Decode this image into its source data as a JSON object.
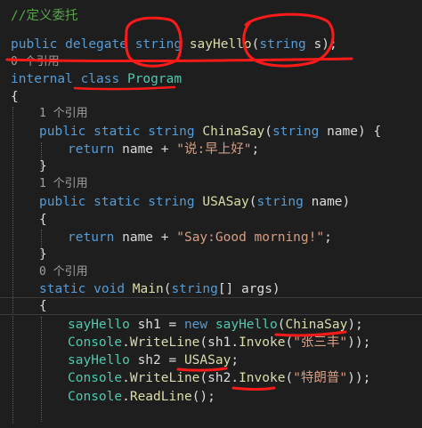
{
  "code": {
    "comment": "//定义委托",
    "l1": {
      "kw1": "public",
      "kw2": "delegate",
      "kw3": "string",
      "fn": "sayHello",
      "p1": "(",
      "kw4": "string",
      "rest": " s);"
    },
    "ref0a": "0 个引用",
    "l3": {
      "kw1": "internal",
      "kw2": "class",
      "cls": "Program"
    },
    "brace_open": "{",
    "ref1a": "1 个引用",
    "l6": {
      "kw1": "public",
      "kw2": "static",
      "kw3": "string",
      "fn": "ChinaSay",
      "p1": "(",
      "kw4": "string",
      "rest": " name) {"
    },
    "l7": {
      "kw": "return",
      "mid": " name + ",
      "str": "\"说:早上好\"",
      "end": ";"
    },
    "brace_close": "}",
    "ref1b": "1 个引用",
    "l10": {
      "kw1": "public",
      "kw2": "static",
      "kw3": "string",
      "fn": "USASay",
      "p1": "(",
      "kw4": "string",
      "rest": " name)"
    },
    "brace_open2": "{",
    "l12": {
      "kw": "return",
      "mid": " name + ",
      "str": "\"Say:Good morning!\"",
      "end": ";"
    },
    "brace_close2": "}",
    "ref0b": "0 个引用",
    "l15": {
      "kw1": "static",
      "kw2": "void",
      "fn": "Main",
      "p1": "(",
      "kw3": "string",
      "rest": "[] args)"
    },
    "brace_open3": "{",
    "l17": {
      "cls": "sayHello",
      "mid": " sh1 = ",
      "kw": "new",
      "sp": " ",
      "cls2": "sayHello",
      "p": "(",
      "fn": "ChinaSay",
      "end": ");"
    },
    "l18": {
      "cls": "Console",
      "dot": ".",
      "fn": "WriteLine",
      "mid": "(sh1.",
      "fn2": "Invoke",
      "p": "(",
      "str": "\"张三丰\"",
      "end": "));"
    },
    "l19": {
      "cls": "sayHello",
      "mid": " sh2 = ",
      "fn": "USASay",
      "end": ";"
    },
    "l20": {
      "cls": "Console",
      "dot": ".",
      "fn": "WriteLine",
      "mid": "(sh2.",
      "fn2": "Invoke",
      "p": "(",
      "str": "\"特朗普\"",
      "end": "));"
    },
    "l21": {
      "cls": "Console",
      "dot": ".",
      "fn": "ReadLine",
      "end": "();"
    }
  },
  "colors": {
    "background": "#1e1e1e",
    "keyword": "#569cd6",
    "type": "#4ec9b0",
    "method": "#dcdcaa",
    "string": "#d69d85",
    "comment": "#57a64a",
    "annotation": "#ff1a1a"
  }
}
